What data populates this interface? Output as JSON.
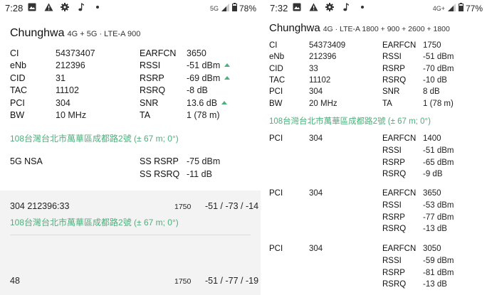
{
  "left": {
    "status": {
      "time": "7:28",
      "network": "5G",
      "battery": "78%"
    },
    "operator": "Chunghwa",
    "tech": "4G + 5G · LTE-A 900",
    "rows": [
      {
        "l1": "CI",
        "v1": "54373407",
        "l2": "EARFCN",
        "v2": "3650",
        "up": false
      },
      {
        "l1": "eNb",
        "v1": "212396",
        "l2": "RSSI",
        "v2": "-51 dBm",
        "up": true
      },
      {
        "l1": "CID",
        "v1": "31",
        "l2": "RSRP",
        "v2": "-69 dBm",
        "up": true
      },
      {
        "l1": "TAC",
        "v1": "11102",
        "l2": "RSRQ",
        "v2": "-8 dB",
        "up": false
      },
      {
        "l1": "PCI",
        "v1": "304",
        "l2": "SNR",
        "v2": "13.6 dB",
        "up": true
      },
      {
        "l1": "BW",
        "v1": "10 MHz",
        "l2": "TA",
        "v2": "1 (78 m)",
        "up": false
      }
    ],
    "address": "108台灣台北市萬華區成都路2號 (± 67 m; 0°)",
    "nsa": {
      "label": "5G NSA",
      "ss_rsrp_label": "SS RSRP",
      "ss_rsrp": "-75 dBm",
      "ss_rsrq_label": "SS RSRQ",
      "ss_rsrq": "-11 dB"
    },
    "cells": [
      {
        "id": "304   212396:33",
        "earfcn": "1750",
        "vals": "-51 / -73 / -14",
        "address": "108台灣台北市萬華區成都路2號 (± 67 m; 0°)"
      },
      {
        "id": "48",
        "earfcn": "1750",
        "vals": "-51 / -77 / -19",
        "address": ""
      }
    ]
  },
  "right": {
    "status": {
      "time": "7:32",
      "network": "4G+",
      "battery": "77%"
    },
    "operator": "Chunghwa",
    "tech": "4G · LTE-A 1800 + 900 + 2600 + 1800",
    "rows": [
      {
        "l1": "CI",
        "v1": "54373409",
        "l2": "EARFCN",
        "v2": "1750"
      },
      {
        "l1": "eNb",
        "v1": "212396",
        "l2": "RSSI",
        "v2": "-51 dBm"
      },
      {
        "l1": "CID",
        "v1": "33",
        "l2": "RSRP",
        "v2": "-70 dBm"
      },
      {
        "l1": "TAC",
        "v1": "11102",
        "l2": "RSRQ",
        "v2": "-10 dB"
      },
      {
        "l1": "PCI",
        "v1": "304",
        "l2": "SNR",
        "v2": "8 dB"
      },
      {
        "l1": "BW",
        "v1": "20 MHz",
        "l2": "TA",
        "v2": "1 (78 m)"
      }
    ],
    "address": "108台灣台北市萬華區成都路2號 (± 67 m; 0°)",
    "neighbors": [
      {
        "pci_label": "PCI",
        "pci": "304",
        "rows": [
          [
            "EARFCN",
            "1400"
          ],
          [
            "RSSI",
            "-51 dBm"
          ],
          [
            "RSRP",
            "-65 dBm"
          ],
          [
            "RSRQ",
            "-9 dB"
          ]
        ]
      },
      {
        "pci_label": "PCI",
        "pci": "304",
        "rows": [
          [
            "EARFCN",
            "3650"
          ],
          [
            "RSSI",
            "-53 dBm"
          ],
          [
            "RSRP",
            "-77 dBm"
          ],
          [
            "RSRQ",
            "-13 dB"
          ]
        ]
      },
      {
        "pci_label": "PCI",
        "pci": "304",
        "rows": [
          [
            "EARFCN",
            "3050"
          ],
          [
            "RSSI",
            "-59 dBm"
          ],
          [
            "RSRP",
            "-81 dBm"
          ],
          [
            "RSRQ",
            "-13 dB"
          ]
        ]
      }
    ]
  }
}
